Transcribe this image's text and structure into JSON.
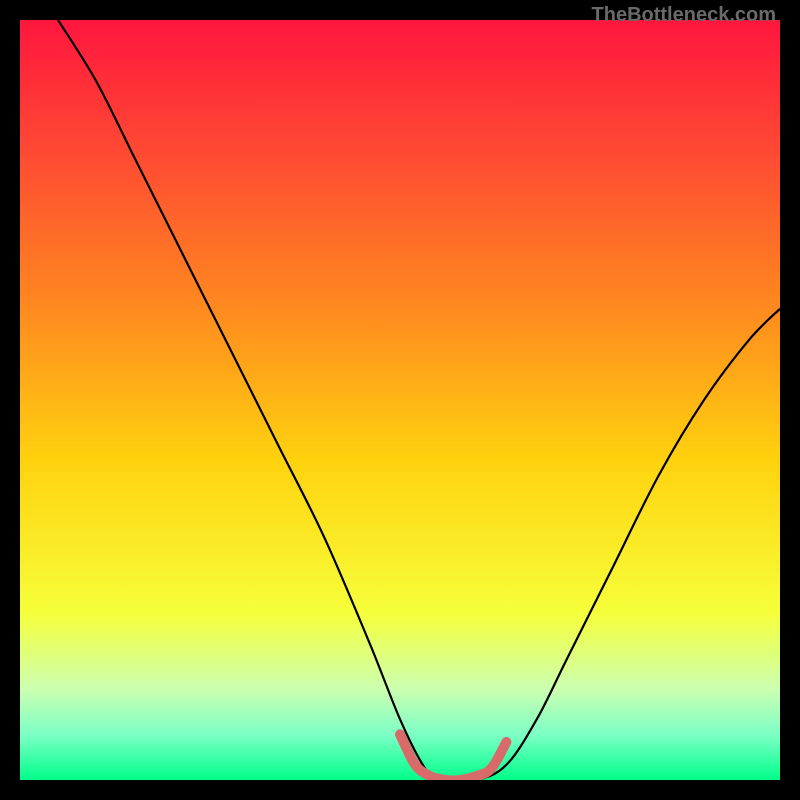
{
  "watermark": "TheBottleneck.com",
  "chart_data": {
    "type": "line",
    "title": "",
    "xlabel": "",
    "ylabel": "",
    "xlim": [
      0,
      100
    ],
    "ylim": [
      0,
      100
    ],
    "gradient_colors": [
      {
        "stop": 0.0,
        "color": "#ff163e"
      },
      {
        "stop": 0.18,
        "color": "#ff4b32"
      },
      {
        "stop": 0.38,
        "color": "#ff8a1f"
      },
      {
        "stop": 0.58,
        "color": "#ffd20e"
      },
      {
        "stop": 0.78,
        "color": "#f6ff3a"
      },
      {
        "stop": 0.88,
        "color": "#ccffb0"
      },
      {
        "stop": 0.94,
        "color": "#7dffc6"
      },
      {
        "stop": 1.0,
        "color": "#00ff8a"
      }
    ],
    "series": [
      {
        "name": "bottleneck-curve",
        "color": "#000000",
        "x": [
          5,
          10,
          15,
          18,
          22,
          28,
          34,
          40,
          46,
          50,
          53,
          55,
          60,
          64,
          68,
          72,
          78,
          84,
          90,
          96,
          100
        ],
        "y": [
          100,
          92,
          82,
          76,
          68,
          56,
          44,
          32,
          18,
          8,
          2,
          0,
          0,
          2,
          8,
          16,
          28,
          40,
          50,
          58,
          62
        ]
      },
      {
        "name": "optimal-band",
        "color": "#d96a6a",
        "thick": true,
        "x": [
          50,
          52,
          54,
          56,
          58,
          60,
          62,
          64
        ],
        "y": [
          6,
          2,
          0.5,
          0,
          0,
          0.5,
          1.5,
          5
        ]
      }
    ]
  }
}
